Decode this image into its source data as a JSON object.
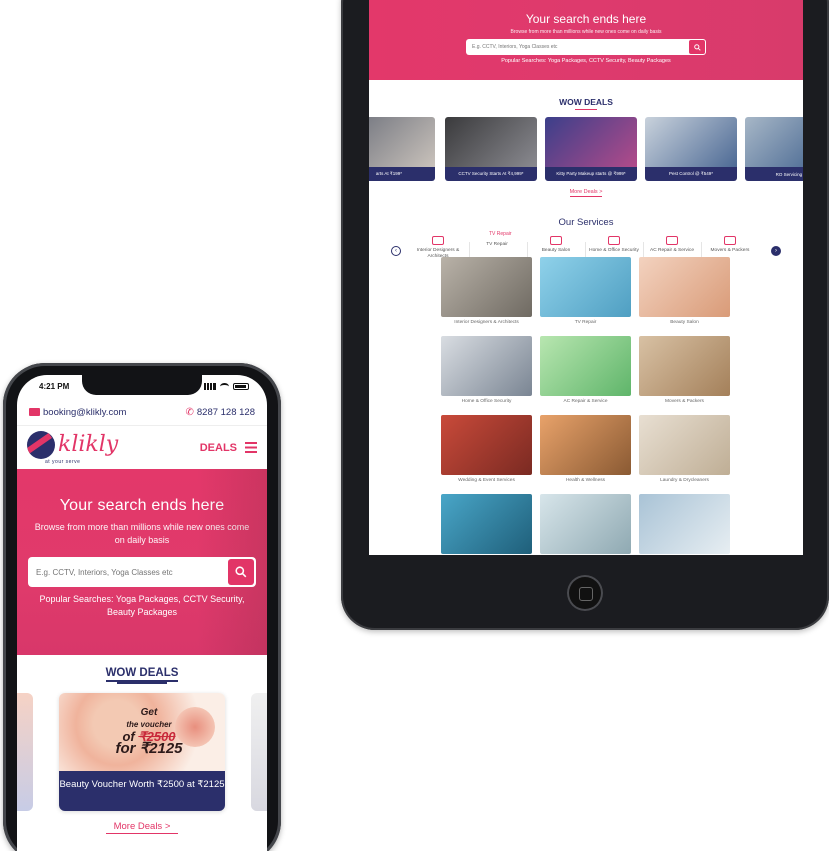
{
  "tablet": {
    "hero": {
      "title": "Your search ends here",
      "subtitle": "Browse from more than millions while new ones come on daily basis",
      "search_placeholder": "E.g. CCTV, Interiors, Yoga Classes etc",
      "popular": "Popular Searches: Yoga Packages, CCTV Security, Beauty Packages"
    },
    "wow_deals_title": "WOW DEALS",
    "deals": [
      {
        "caption": "arts At ₹199*",
        "color_a": "#6b6f7a",
        "color_b": "#c9c2bb"
      },
      {
        "caption": "CCTV Security Starts At ₹4,999*",
        "color_a": "#3a3a3c",
        "color_b": "#8a8a90"
      },
      {
        "caption": "Kitty Party Makeup starts @ ₹999*",
        "color_a": "#3b3f8a",
        "color_b": "#b24b8a"
      },
      {
        "caption": "Pest Control @ ₹549*",
        "color_a": "#c9d2dc",
        "color_b": "#4d6a95"
      },
      {
        "caption": "RO Servicing &",
        "color_a": "#a7b7c7",
        "color_b": "#3e5f8c"
      }
    ],
    "more_deals": "More Deals >",
    "services_title": "Our Services",
    "services": [
      "Interior Designers & Architects",
      "TV Repair",
      "Beauty Salon",
      "Home & Office Security",
      "AC Repair & Service",
      "Movers & Packers"
    ],
    "tv_repair_tooltip": "TV Repair",
    "tiles": [
      {
        "label": "Interior Designers & Architects",
        "c1": "#b9b2a8",
        "c2": "#6f6a62"
      },
      {
        "label": "TV Repair",
        "c1": "#8fd1ea",
        "c2": "#4f9fc2"
      },
      {
        "label": "Beauty Salon",
        "c1": "#f3d2bf",
        "c2": "#d99b78"
      },
      {
        "label": "Home & Office Security",
        "c1": "#d9dde2",
        "c2": "#7a8593"
      },
      {
        "label": "AC Repair & Service",
        "c1": "#b8e6b0",
        "c2": "#5fb56a"
      },
      {
        "label": "Movers & Packers",
        "c1": "#d8c1a4",
        "c2": "#a4805a"
      },
      {
        "label": "Wedding & Event Services",
        "c1": "#c94a3a",
        "c2": "#7a2a22"
      },
      {
        "label": "Health & Wellness",
        "c1": "#e8a26a",
        "c2": "#8a5a33"
      },
      {
        "label": "Laundry & Drycleaners",
        "c1": "#e8dfd2",
        "c2": "#bfae95"
      },
      {
        "label": "",
        "c1": "#49a6c8",
        "c2": "#1f5f7a"
      },
      {
        "label": "",
        "c1": "#d7e5ea",
        "c2": "#8fa9b2"
      },
      {
        "label": "",
        "c1": "#a9c3d6",
        "c2": "#e7eef2"
      }
    ]
  },
  "phone": {
    "time": "4:21 PM",
    "email": "booking@klikly.com",
    "phone_number": "8287 128 128",
    "logo_text": "klikly",
    "logo_tagline": "at your serve",
    "deals_link": "DEALS",
    "hero": {
      "title": "Your search ends here",
      "subtitle": "Browse from more than millions while new ones come on daily basis",
      "search_placeholder": "E.g. CCTV, Interiors, Yoga Classes etc",
      "popular": "Popular Searches: Yoga Packages, CCTV Security, Beauty Packages"
    },
    "wow_deals_title": "WOW DEALS",
    "offer": {
      "line1": "Get",
      "line2": "the voucher",
      "line3_prefix": "of ",
      "line3_strike": "₹2500",
      "line4": "for ₹2125"
    },
    "deal_caption": "Beauty Voucher Worth ₹2500 at ₹2125",
    "more_deals": "More Deals >"
  },
  "colors": {
    "brand_pink": "#e23567",
    "brand_navy": "#2b2f6b"
  }
}
